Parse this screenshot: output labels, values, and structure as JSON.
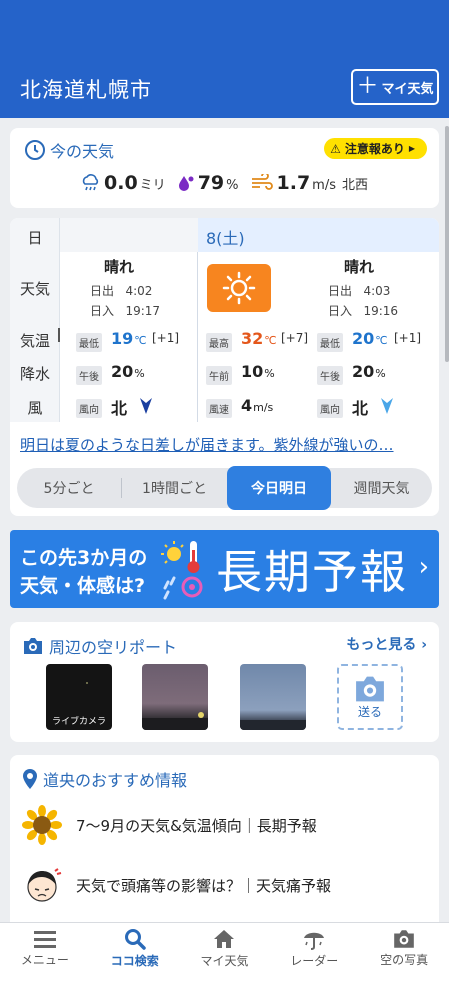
{
  "header": {
    "title": "北海道札幌市",
    "add_button_label": "マイ天気",
    "add_button_icon": "plus-icon"
  },
  "current": {
    "title": "今の天気",
    "alert_label": "注意報あり",
    "precip_value": "0.0",
    "precip_unit": "ミリ",
    "humidity_value": "79",
    "humidity_unit": "%",
    "wind_value": "1.7",
    "wind_unit": "m/s",
    "wind_dir": "北西"
  },
  "forecast": {
    "row_labels": [
      "日",
      "天気",
      "気温",
      "降水",
      "風"
    ],
    "date": "8(土)",
    "prev_night": {
      "weather": "晴れ",
      "sunrise_label": "日出",
      "sunrise": "4:02",
      "sunset_label": "日入",
      "sunset": "19:17",
      "temp_label": "最低",
      "temp": "19",
      "temp_unit": "℃",
      "temp_diff": "[+1]",
      "precip_label": "午後",
      "precip": "20",
      "precip_unit": "%",
      "wind_label": "風向",
      "wind": "北"
    },
    "day": {
      "weather_icon": "sunny-icon",
      "temp_label": "最高",
      "temp": "32",
      "temp_unit": "℃",
      "temp_diff": "[+7]",
      "precip_label": "午前",
      "precip": "10",
      "precip_unit": "%",
      "wind_label": "風速",
      "wind": "4",
      "wind_unit": "m/s"
    },
    "next": {
      "weather": "晴れ",
      "sunrise_label": "日出",
      "sunrise": "4:03",
      "sunset_label": "日入",
      "sunset": "19:16",
      "temp_label": "最低",
      "temp": "20",
      "temp_unit": "℃",
      "temp_diff": "[+1]",
      "precip_label": "午後",
      "precip": "20",
      "precip_unit": "%",
      "wind_label": "風向",
      "wind": "北"
    },
    "headline": "明日は夏のような日差しが届きます。紫外線が強いの…",
    "tabs": [
      "5分ごと",
      "1時間ごと",
      "今日明日",
      "週間天気"
    ],
    "active_tab": "今日明日"
  },
  "banner": {
    "line1": "この先3か月の",
    "line2": "天気・体感は?",
    "big": "長期予報"
  },
  "sky_report": {
    "title": "周辺の空リポート",
    "more": "もっと見る",
    "live_caption": "ライブカメラ",
    "send_label": "送る"
  },
  "recommend": {
    "title": "道央のおすすめ情報",
    "items": [
      {
        "icon": "sunflower-icon",
        "text": "7〜9月の天気&気温傾向｜長期予報"
      },
      {
        "icon": "headache-icon",
        "text": "天気で頭痛等の影響は？｜天気痛予報"
      }
    ]
  },
  "nav": {
    "items": [
      {
        "label": "メニュー",
        "icon": "menu-icon"
      },
      {
        "label": "ココ検索",
        "icon": "search-icon"
      },
      {
        "label": "マイ天気",
        "icon": "home-icon"
      },
      {
        "label": "レーダー",
        "icon": "radar-icon"
      },
      {
        "label": "空の写真",
        "icon": "camera-icon"
      }
    ],
    "active": "ココ検索"
  },
  "colors": {
    "header": "#2563c9",
    "accent": "#2f7fe0",
    "alert": "#ffe000",
    "sun_box": "#f7851f",
    "temp_high": "#e4571b",
    "temp_low": "#1f74cc"
  }
}
